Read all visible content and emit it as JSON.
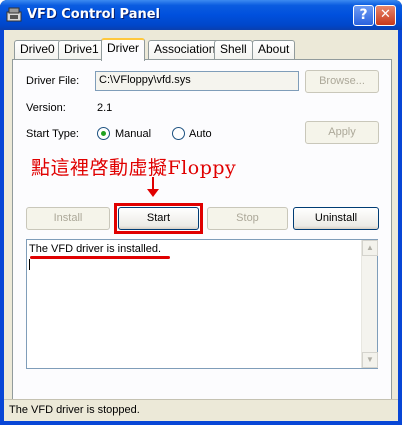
{
  "window": {
    "title": "VFD Control Panel",
    "help_label": "?",
    "close_label": "✕"
  },
  "tabs": [
    {
      "label": "Drive0"
    },
    {
      "label": "Drive1"
    },
    {
      "label": "Driver",
      "active": true
    },
    {
      "label": "Association"
    },
    {
      "label": "Shell"
    },
    {
      "label": "About"
    }
  ],
  "driver": {
    "file_label": "Driver File:",
    "file_value": "C:\\VFloppy\\vfd.sys",
    "browse_label": "Browse...",
    "version_label": "Version:",
    "version_value": "2.1",
    "start_type_label": "Start Type:",
    "manual_label": "Manual",
    "auto_label": "Auto",
    "start_type_selected": "Manual",
    "apply_label": "Apply"
  },
  "annotation": {
    "text": "點這裡啓動虛擬Floppy",
    "color": "#e00000"
  },
  "buttons": {
    "install_label": "Install",
    "start_label": "Start",
    "stop_label": "Stop",
    "uninstall_label": "Uninstall"
  },
  "log": {
    "text": "The VFD driver is installed."
  },
  "status": {
    "text": "The VFD driver is stopped."
  }
}
